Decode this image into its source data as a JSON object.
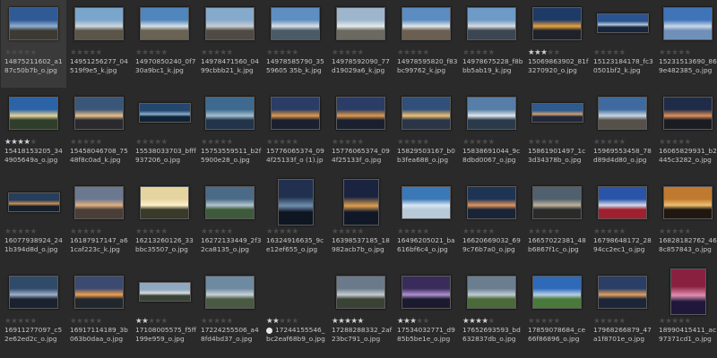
{
  "colors": {
    "background": "#2a2a2a",
    "text": "#c6c6c6",
    "star_on": "#d2d2d2",
    "star_off": "#4c4c4c"
  },
  "thumbnails": [
    {
      "file": "14875211602_a187c50b7b_o.jpg",
      "rating": 0,
      "orient": "land",
      "sky": "#2f5a95",
      "mid": "#8fb0d0",
      "ground": "#3d3a34"
    },
    {
      "file": "14951256277_04519f9e5_k.jpg",
      "rating": 0,
      "orient": "land",
      "sky": "#7aa6cc",
      "mid": "#cfd8de",
      "ground": "#5b5448"
    },
    {
      "file": "14970850240_0f730a9bc1_k.jpg",
      "rating": 0,
      "orient": "land",
      "sky": "#4f86bd",
      "mid": "#d6e0e8",
      "ground": "#6a6252"
    },
    {
      "file": "14978471560_0499cbbb21_k.jpg",
      "rating": 0,
      "orient": "land",
      "sky": "#86aacb",
      "mid": "#c9ced2",
      "ground": "#4f4b44"
    },
    {
      "file": "14978585790_3559605 35b_k.jpg",
      "rating": 0,
      "orient": "land",
      "sky": "#5f8fc0",
      "mid": "#d9e0e6",
      "ground": "#4a5a66"
    },
    {
      "file": "14978592090_77d19029a6_k.jpg",
      "rating": 0,
      "orient": "land",
      "sky": "#9db6cc",
      "mid": "#e6ebee",
      "ground": "#6b6960"
    },
    {
      "file": "14978595820_f83bc99762_k.jpg",
      "rating": 0,
      "orient": "land",
      "sky": "#5b8cc2",
      "mid": "#e2e6ea",
      "ground": "#6a5f50"
    },
    {
      "file": "14978675228_f8bbb5ab19_k.jpg",
      "rating": 0,
      "orient": "land",
      "sky": "#6d9ac7",
      "mid": "#d9dde0",
      "ground": "#3b4652"
    },
    {
      "file": "15069863902_81f3270920_o.jpg",
      "rating": 3,
      "orient": "land",
      "sky": "#1e3a66",
      "mid": "#e8a343",
      "ground": "#20222a"
    },
    {
      "file": "15123184178_fc30501bf2_k.jpg",
      "rating": 0,
      "orient": "wide",
      "sky": "#2a5490",
      "mid": "#b8c8da",
      "ground": "#17263c"
    },
    {
      "file": "15231513690_869e482385_o.jpg",
      "rating": 0,
      "orient": "land",
      "sky": "#3f74b8",
      "mid": "#c9d8e8",
      "ground": "#6f90b8"
    },
    {
      "file": "15418153205_344905649a_o.jpg",
      "rating": 4,
      "orient": "land",
      "sky": "#2c63a6",
      "mid": "#e6d49a",
      "ground": "#2f3e2a"
    },
    {
      "file": "15458046708_7548f8c0ad_k.jpg",
      "rating": 0,
      "orient": "land",
      "sky": "#3a5678",
      "mid": "#e8c08a",
      "ground": "#2a2a2e"
    },
    {
      "file": "15538033703_bfff937206_o.jpg",
      "rating": 0,
      "orient": "wide",
      "sky": "#24476e",
      "mid": "#8ab0cc",
      "ground": "#102236"
    },
    {
      "file": "15753559511_b2f5900e28_o.jpg",
      "rating": 0,
      "orient": "land",
      "sky": "#3d6a8e",
      "mid": "#a4c0d0",
      "ground": "#22344a"
    },
    {
      "file": "15776065374_094f25133f_o (1).jpg",
      "rating": 0,
      "orient": "land",
      "sky": "#2b3c66",
      "mid": "#e09a4a",
      "ground": "#1a2030"
    },
    {
      "file": "15776065374_094f25133f_o.jpg",
      "rating": 0,
      "orient": "land",
      "sky": "#2b3c66",
      "mid": "#e09a4a",
      "ground": "#1a2030"
    },
    {
      "file": "15829503167_b0b3fea688_o.jpg",
      "rating": 0,
      "orient": "land",
      "sky": "#30507a",
      "mid": "#f0c070",
      "ground": "#2a3548"
    },
    {
      "file": "15838691044_9c8dbd0067_o.jpg",
      "rating": 0,
      "orient": "land",
      "sky": "#567ea6",
      "mid": "#e0e6ec",
      "ground": "#2a3a4a"
    },
    {
      "file": "15861901497_1c3d34378b_o.jpg",
      "rating": 0,
      "orient": "wide",
      "sky": "#2e5a8c",
      "mid": "#d0a070",
      "ground": "#20283a"
    },
    {
      "file": "15969553458_78d89d4d80_o.jpg",
      "rating": 0,
      "orient": "land",
      "sky": "#3e6aa0",
      "mid": "#c9d6e2",
      "ground": "#55504a"
    },
    {
      "file": "16065829931_b2445c3282_o.jpg",
      "rating": 0,
      "orient": "land",
      "sky": "#1f2c48",
      "mid": "#e0905a",
      "ground": "#1a1c22"
    },
    {
      "file": "16077938924_241b394d8d_o.jpg",
      "rating": 0,
      "orient": "wide",
      "sky": "#243e5c",
      "mid": "#d09050",
      "ground": "#15202c"
    },
    {
      "file": "16187917147_a61caf223c_k.jpg",
      "rating": 0,
      "orient": "land",
      "sky": "#6a7890",
      "mid": "#e0b080",
      "ground": "#4a3e38"
    },
    {
      "file": "16213260126_33bbc35507_o.jpg",
      "rating": 0,
      "orient": "land",
      "sky": "#e6d4a0",
      "mid": "#fff2c8",
      "ground": "#3a3a2a"
    },
    {
      "file": "16272133449_2f32ca8135_o.jpg",
      "rating": 0,
      "orient": "land",
      "sky": "#4a6a88",
      "mid": "#b4c6d0",
      "ground": "#3f5a3a"
    },
    {
      "file": "16324916635_9ce12ef655_o.jpg",
      "rating": 0,
      "orient": "tall",
      "sky": "#20304e",
      "mid": "#7090b0",
      "ground": "#0e1622"
    },
    {
      "file": "16398537185_18982acb7b_o.jpg",
      "rating": 0,
      "orient": "tall",
      "sky": "#1a2440",
      "mid": "#e0a050",
      "ground": "#101828"
    },
    {
      "file": "16496205021_ba616bf6c4_o.jpg",
      "rating": 0,
      "orient": "land",
      "sky": "#3a78b8",
      "mid": "#d8e6f2",
      "ground": "#b8cad8"
    },
    {
      "file": "16620669032_699c76b7a0_o.jpg",
      "rating": 0,
      "orient": "land",
      "sky": "#1e3454",
      "mid": "#e09860",
      "ground": "#1a2436"
    },
    {
      "file": "16657022381_48b6867f1c_o.jpg",
      "rating": 0,
      "orient": "land",
      "sky": "#50606e",
      "mid": "#c0b29c",
      "ground": "#2a2a2a"
    },
    {
      "file": "16798648172_2894cc2ec1_o.jpg",
      "rating": 0,
      "orient": "land",
      "sky": "#2a54a8",
      "mid": "#d0dcee",
      "ground": "#a02030"
    },
    {
      "file": "16828182762_468c857843_o.jpg",
      "rating": 0,
      "orient": "land",
      "sky": "#c07a30",
      "mid": "#f0c070",
      "ground": "#201810"
    },
    {
      "file": "16911277097_c52e62ed2c_o.jpg",
      "rating": 0,
      "orient": "land",
      "sky": "#304a6a",
      "mid": "#a0b0c8",
      "ground": "#1a2230"
    },
    {
      "file": "16917114189_3b063b0daa_o.jpg",
      "rating": 0,
      "orient": "land",
      "sky": "#3a4a70",
      "mid": "#f0a050",
      "ground": "#20282e"
    },
    {
      "file": "17108005575_f5ff199e959_o.jpg",
      "rating": 2,
      "orient": "wide",
      "sky": "#8fa8c0",
      "mid": "#d8dde0",
      "ground": "#3a4236"
    },
    {
      "file": "17224255506_a48fd4bd37_o.jpg",
      "rating": 0,
      "orient": "land",
      "sky": "#6e8aa0",
      "mid": "#c8d2d8",
      "ground": "#4a5a42"
    },
    {
      "file": "17244155546_bc2eaf68b9_o.jpg",
      "rating": 2,
      "orient": "land",
      "sky": "#2a2a2a",
      "mid": "#2a2a2a",
      "ground": "#2a2a2a",
      "dot": true
    },
    {
      "file": "17288288332_2af23bc791_o.jpg",
      "rating": 5,
      "orient": "land",
      "sky": "#6a7a8a",
      "mid": "#c6ccd0",
      "ground": "#3a4236"
    },
    {
      "file": "17534032771_d985b5be1e_o.jpg",
      "rating": 3,
      "orient": "land",
      "sky": "#3a2c5a",
      "mid": "#b090d0",
      "ground": "#1c1a2e"
    },
    {
      "file": "17652693593_bd632837db_o.jpg",
      "rating": 4,
      "orient": "land",
      "sky": "#6a7e90",
      "mid": "#c0ccd4",
      "ground": "#4a6a3a"
    },
    {
      "file": "17859078684_ce66f86896_o.jpg",
      "rating": 0,
      "orient": "land",
      "sky": "#2e6ab8",
      "mid": "#b8d0e8",
      "ground": "#4a7a3a"
    },
    {
      "file": "17968266879_47a1f8701e_o.jpg",
      "rating": 0,
      "orient": "land",
      "sky": "#2a3e66",
      "mid": "#e0a060",
      "ground": "#1c2638"
    },
    {
      "file": "18990415411_ac97371cd1_o.jpg",
      "rating": 0,
      "orient": "tall",
      "sky": "#8a2040",
      "mid": "#e090b0",
      "ground": "#20183a"
    }
  ]
}
